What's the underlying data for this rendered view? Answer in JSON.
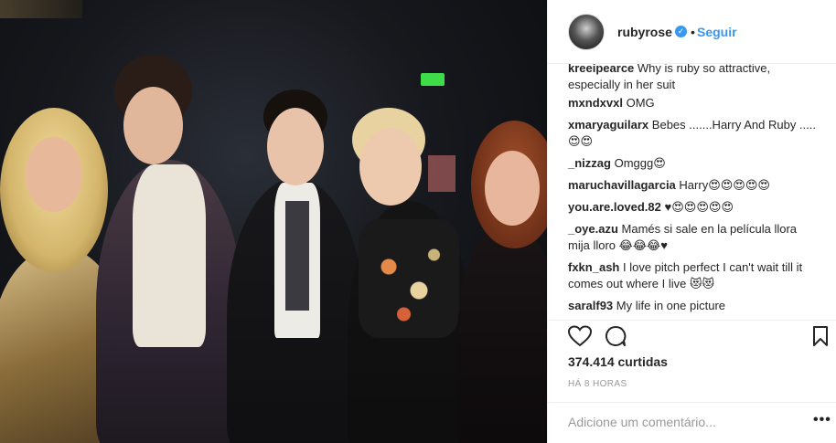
{
  "post": {
    "username": "rubyrose",
    "follow_label": "Seguir",
    "dot": "•",
    "verified_glyph": "✓",
    "likes": "374.414 curtidas",
    "time": "HÁ 8 HORAS",
    "add_comment_placeholder": "Adicione um comentário...",
    "more_glyph": "•••"
  },
  "comments": [
    {
      "user": "kreeipearce",
      "text": "Why is ruby so attractive, especially in her suit"
    },
    {
      "user": "mxndxvxl",
      "text": "OMG"
    },
    {
      "user": "xmaryaguilarx",
      "text": "Bebes .......Harry And Ruby .....😍😍"
    },
    {
      "user": "_nizzag",
      "text": "Omggg😍"
    },
    {
      "user": "maruchavillagarcia",
      "text": "Harry😍😍😍😍😍"
    },
    {
      "user": "you.are.loved.82",
      "text": "♥😍😍😍😍😍"
    },
    {
      "user": "_oye.azu",
      "text": "Mamés si sale en la película llora mija lloro 😂😂😂♥"
    },
    {
      "user": "fxkn_ash",
      "text": "I love pitch perfect I can't wait till it comes out where I live 😻😻"
    },
    {
      "user": "saralf93",
      "text": "My life in one picture"
    }
  ],
  "icons": [
    "heart-icon",
    "comment-icon",
    "bookmark-icon",
    "verified-icon",
    "avatar",
    "more-options-icon"
  ],
  "colors": {
    "accent": "#3897f0",
    "text": "#262626",
    "muted": "#999999",
    "border": "#efefef"
  }
}
